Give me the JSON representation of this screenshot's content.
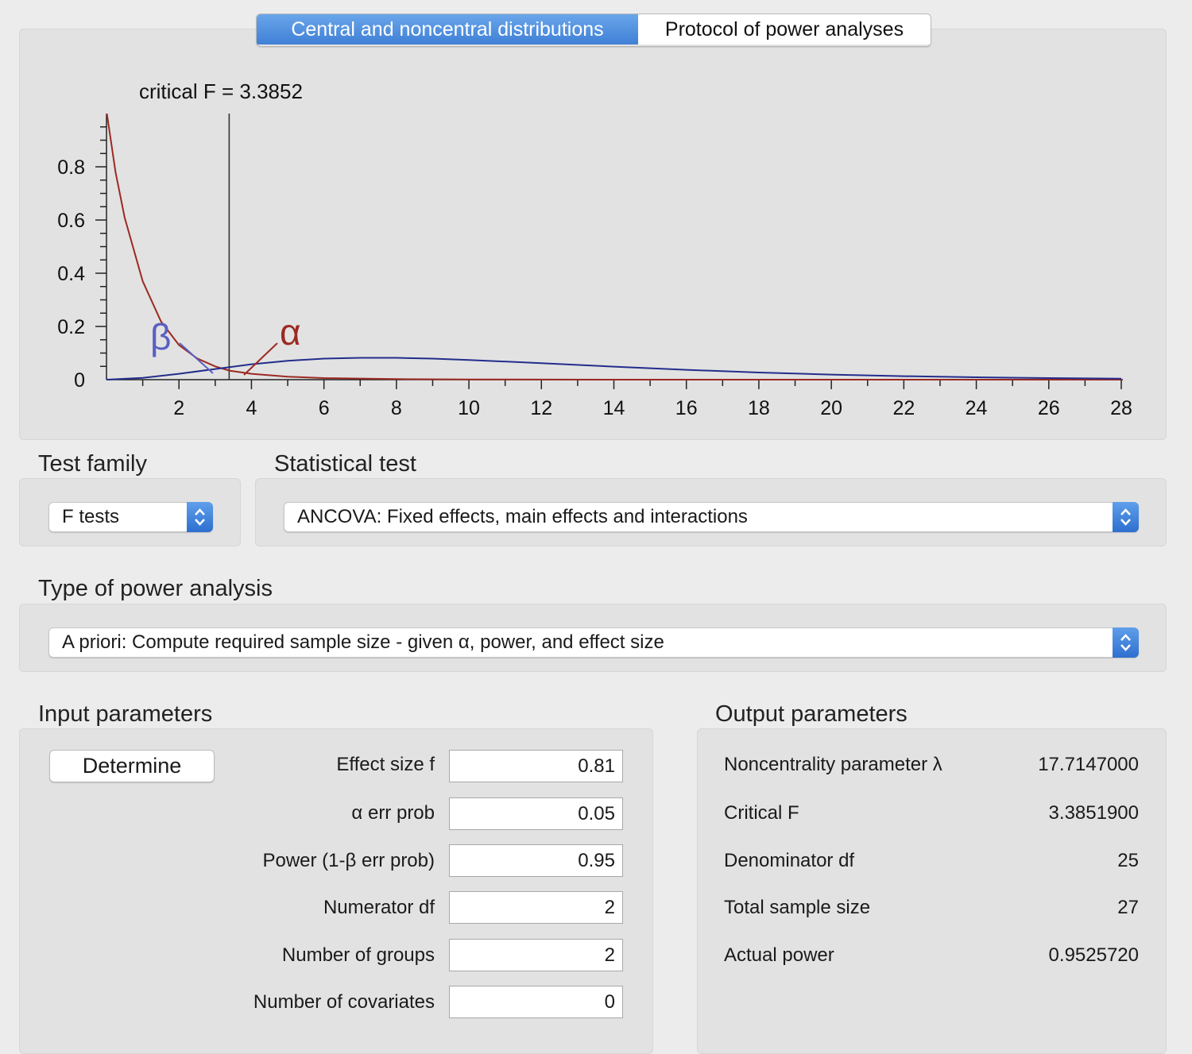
{
  "tabs": [
    {
      "label": "Central and noncentral distributions",
      "active": true
    },
    {
      "label": "Protocol of power analyses",
      "active": false
    }
  ],
  "chart_data": {
    "type": "line",
    "annotation": "critical F = 3.3852",
    "critical_f": 3.3852,
    "xlim": [
      0,
      28
    ],
    "ylim": [
      0,
      1
    ],
    "x_ticks": [
      "2",
      "4",
      "6",
      "8",
      "10",
      "12",
      "14",
      "16",
      "18",
      "20",
      "22",
      "24",
      "26",
      "28"
    ],
    "y_ticks": [
      "0",
      "0.2",
      "0.4",
      "0.6",
      "0.8"
    ],
    "region_labels": {
      "beta": "β",
      "alpha": "α"
    },
    "series": [
      {
        "color": "#9b2a22",
        "x": [
          0.01,
          0.25,
          0.5,
          1,
          1.5,
          2,
          2.5,
          3,
          3.39,
          4,
          5,
          6,
          8,
          10,
          14,
          28
        ],
        "y": [
          1.0,
          0.78,
          0.61,
          0.37,
          0.22,
          0.13,
          0.08,
          0.05,
          0.034,
          0.022,
          0.011,
          0.006,
          0.002,
          0.001,
          0.0001,
          0.0
        ]
      },
      {
        "color": "#232d8c",
        "x": [
          0,
          1,
          2,
          3,
          4,
          5,
          6,
          7,
          8,
          9,
          10,
          12,
          14,
          16,
          18,
          20,
          22,
          24,
          26,
          28
        ],
        "y": [
          0,
          0.007,
          0.022,
          0.04,
          0.058,
          0.071,
          0.079,
          0.082,
          0.082,
          0.079,
          0.074,
          0.062,
          0.049,
          0.037,
          0.027,
          0.019,
          0.013,
          0.009,
          0.006,
          0.004
        ]
      }
    ]
  },
  "test_family": {
    "label": "Test family",
    "value": "F tests"
  },
  "statistical_test": {
    "label": "Statistical test",
    "value": "ANCOVA: Fixed effects, main effects and interactions"
  },
  "power_analysis": {
    "label": "Type of power analysis",
    "value": "A priori: Compute required sample size - given α, power, and effect size"
  },
  "input": {
    "title": "Input parameters",
    "determine_label": "Determine",
    "fields": [
      {
        "label": "Effect size f",
        "value": "0.81"
      },
      {
        "label": "α err prob",
        "value": "0.05"
      },
      {
        "label": "Power (1-β err prob)",
        "value": "0.95"
      },
      {
        "label": "Numerator df",
        "value": "2"
      },
      {
        "label": "Number of groups",
        "value": "2"
      },
      {
        "label": "Number of covariates",
        "value": "0"
      }
    ]
  },
  "output": {
    "title": "Output parameters",
    "rows": [
      {
        "label": "Noncentrality parameter λ",
        "value": "17.7147000"
      },
      {
        "label": "Critical F",
        "value": "3.3851900"
      },
      {
        "label": "Denominator df",
        "value": "25"
      },
      {
        "label": "Total sample size",
        "value": "27"
      },
      {
        "label": "Actual power",
        "value": "0.9525720"
      }
    ]
  }
}
